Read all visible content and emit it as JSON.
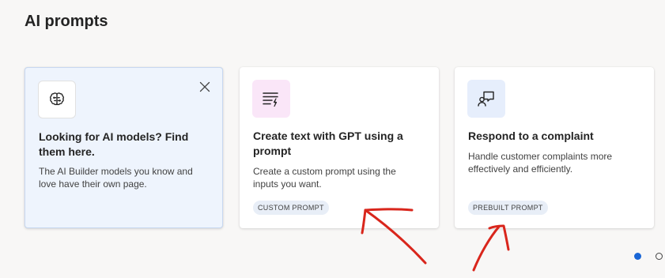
{
  "page": {
    "title": "AI prompts"
  },
  "colors": {
    "accent": "#1a66d6",
    "annotation": "#d9261c",
    "highlight_card_bg": "#eef4fd"
  },
  "cards": [
    {
      "title": "Looking for AI models? Find them here.",
      "description": "The AI Builder models you know and love have their own page.",
      "icon": "brain-icon",
      "close_icon": "close-icon"
    },
    {
      "title": "Create text with GPT using a prompt",
      "description": "Create a custom prompt using the inputs you want.",
      "badge": "CUSTOM PROMPT",
      "icon": "text-generate-icon"
    },
    {
      "title": "Respond to a complaint",
      "description": "Handle customer complaints more effectively and efficiently.",
      "badge": "PREBUILT PROMPT",
      "icon": "person-feedback-icon"
    }
  ],
  "pager": {
    "pages": 2,
    "active": 1
  }
}
